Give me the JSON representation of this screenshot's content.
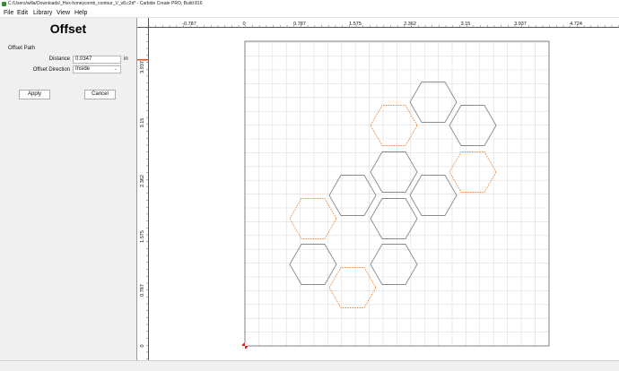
{
  "window": {
    "title": "C:/Users/willa/Downloads/_Hex-honeycomb_contour_V_v8.c2d* - Carbide Create PRO, Build 816"
  },
  "menu": {
    "items": [
      "File",
      "Edit",
      "Library",
      "View",
      "Help"
    ]
  },
  "panel": {
    "heading": "Offset",
    "section": "Offset Path",
    "distance_label": "Distance",
    "distance_value": "0.0347",
    "distance_unit": "in",
    "direction_label": "Offset Direction",
    "direction_value": "Inside",
    "apply_label": "Apply",
    "cancel_label": "Cancel"
  },
  "rulers": {
    "top_labels": [
      "-0.787",
      "0",
      "0.787",
      "1.575",
      "2.362",
      "3.15",
      "3.937",
      "4.724"
    ],
    "left_labels": [
      "3.937",
      "3.15",
      "2.362",
      "1.575",
      "0.787",
      "0"
    ]
  },
  "colors": {
    "selected_path": "#f08a3c",
    "path": "#8a8a8a",
    "grid": "#dcdcdc",
    "ruler_marker": "#e05020"
  },
  "icons": {
    "origin": "origin-marker-icon",
    "dropdown": "chevron-down-icon"
  }
}
